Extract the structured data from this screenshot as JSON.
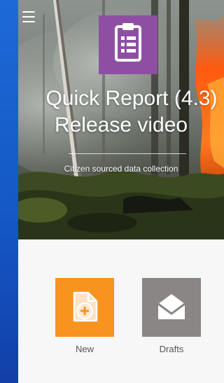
{
  "app": {
    "title_line1": "Quick Report (4.3)",
    "title_line2": "Release video",
    "subtitle": "Citizen sourced data collection"
  },
  "icons": {
    "menu": "hamburger-menu-icon",
    "logo": "clipboard-list-icon",
    "new": "new-document-plus-icon",
    "drafts": "open-envelope-icon"
  },
  "actions": {
    "new_label": "New",
    "drafts_label": "Drafts"
  },
  "colors": {
    "logo_tile": "#8e4fa3",
    "new_tile": "#f7931e",
    "drafts_tile": "#8a8686",
    "page_background": "#f7f7f7",
    "outer_background": "#1565c8"
  }
}
